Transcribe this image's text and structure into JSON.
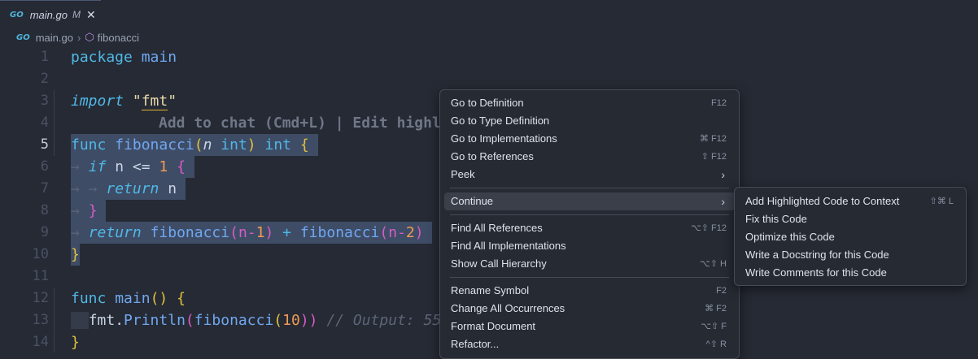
{
  "tab": {
    "icon": "go-file-icon",
    "icon_text": "GO",
    "filename": "main.go",
    "modified": "M",
    "close": "✕"
  },
  "breadcrumb": {
    "file": "main.go",
    "sep": "›",
    "symbol": "fibonacci"
  },
  "editor": {
    "line_numbers": [
      "1",
      "2",
      "3",
      "4",
      "5",
      "6",
      "7",
      "8",
      "9",
      "10",
      "11",
      "12",
      "13",
      "14"
    ],
    "l1": {
      "kw": "package",
      "name": "main"
    },
    "l3": {
      "kw": "import",
      "q1": "\"",
      "pkg": "fmt",
      "q2": "\""
    },
    "l4": {
      "hint": "Add to chat (Cmd+L) | Edit highl"
    },
    "l5": {
      "kw": "func",
      "fn": "fibonacci",
      "p1": "(",
      "param": "n",
      "type": "int",
      "p2": ")",
      "ret": "int",
      "brace": "{"
    },
    "l6": {
      "kw": "if",
      "cond": "n <=",
      "num": "1",
      "brace": "{"
    },
    "l7": {
      "kw": "return",
      "var": "n"
    },
    "l8": {
      "brace": "}"
    },
    "l9": {
      "kw": "return",
      "fn1": "fibonacci",
      "a1": "(n-",
      "n1": "1",
      "c1": ")",
      "op": "+",
      "fn2": "fibonacci",
      "a2": "(n-",
      "n2": "2",
      "c2": ")"
    },
    "l10": {
      "brace": "}"
    },
    "l12": {
      "kw": "func",
      "fn": "main",
      "parens": "()",
      "brace": "{"
    },
    "l13": {
      "pkg": "fmt",
      "dot": ".",
      "fn": "Println",
      "p1": "(",
      "call": "fibonacci",
      "p2": "(",
      "num": "10",
      "p3": "))",
      "comment": "// Output: 55"
    },
    "l14": {
      "brace": "}"
    }
  },
  "context_menu": {
    "items": [
      {
        "label": "Go to Definition",
        "shortcut": "F12"
      },
      {
        "label": "Go to Type Definition",
        "shortcut": ""
      },
      {
        "label": "Go to Implementations",
        "shortcut": "⌘ F12"
      },
      {
        "label": "Go to References",
        "shortcut": "⇧ F12"
      },
      {
        "label": "Peek",
        "shortcut": "›"
      },
      {
        "label": "Continue",
        "shortcut": "›"
      },
      {
        "label": "Find All References",
        "shortcut": "⌥⇧ F12"
      },
      {
        "label": "Find All Implementations",
        "shortcut": ""
      },
      {
        "label": "Show Call Hierarchy",
        "shortcut": "⌥⇧ H"
      },
      {
        "label": "Rename Symbol",
        "shortcut": "F2"
      },
      {
        "label": "Change All Occurrences",
        "shortcut": "⌘ F2"
      },
      {
        "label": "Format Document",
        "shortcut": "⌥⇧ F"
      },
      {
        "label": "Refactor...",
        "shortcut": "^⇧ R"
      }
    ]
  },
  "submenu": {
    "items": [
      {
        "label": "Add Highlighted Code to Context",
        "shortcut": "⇧⌘ L"
      },
      {
        "label": "Fix this Code",
        "shortcut": ""
      },
      {
        "label": "Optimize this Code",
        "shortcut": ""
      },
      {
        "label": "Write a Docstring for this Code",
        "shortcut": ""
      },
      {
        "label": "Write Comments for this Code",
        "shortcut": ""
      }
    ]
  },
  "colors": {
    "background": "#262a34",
    "selection": "#3f4c66",
    "keyword": "#4fb8e6",
    "function": "#6fa8f0",
    "bracket": "#e0c23c",
    "number": "#f09a56"
  }
}
